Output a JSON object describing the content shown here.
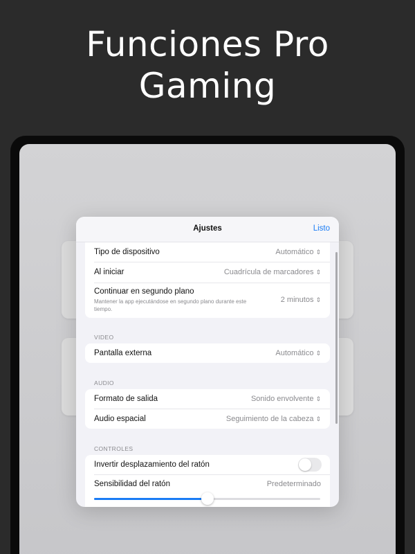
{
  "headline": {
    "line1": "Funciones Pro",
    "line2": "Gaming"
  },
  "sheet": {
    "title": "Ajustes",
    "done_label": "Listo"
  },
  "general": {
    "device_type": {
      "label": "Tipo de dispositivo",
      "value": "Automático"
    },
    "on_launch": {
      "label": "Al iniciar",
      "value": "Cuadrícula de marcadores"
    },
    "background": {
      "label": "Continuar en segundo plano",
      "sublabel": "Mantener la app ejecutándose en segundo plano durante este tiempo.",
      "value": "2 minutos"
    }
  },
  "video": {
    "header": "VIDEO",
    "external_display": {
      "label": "Pantalla externa",
      "value": "Automático"
    }
  },
  "audio": {
    "header": "AUDIO",
    "output_format": {
      "label": "Formato de salida",
      "value": "Sonido envolvente"
    },
    "spatial_audio": {
      "label": "Audio espacial",
      "value": "Seguimiento de la cabeza"
    }
  },
  "controls": {
    "header": "CONTROLES",
    "invert_scroll": {
      "label": "Invertir desplazamiento del ratón",
      "on": false
    },
    "mouse_sensitivity": {
      "label": "Sensibilidad del ratón",
      "value": "Predeterminado",
      "level": 0.5
    }
  },
  "icons": {
    "chevron": "up-down-chevron-icon"
  },
  "colors": {
    "accent": "#1a7cf5",
    "sheet_background": "#f2f2f7",
    "outer_background": "#2b2b2b"
  }
}
